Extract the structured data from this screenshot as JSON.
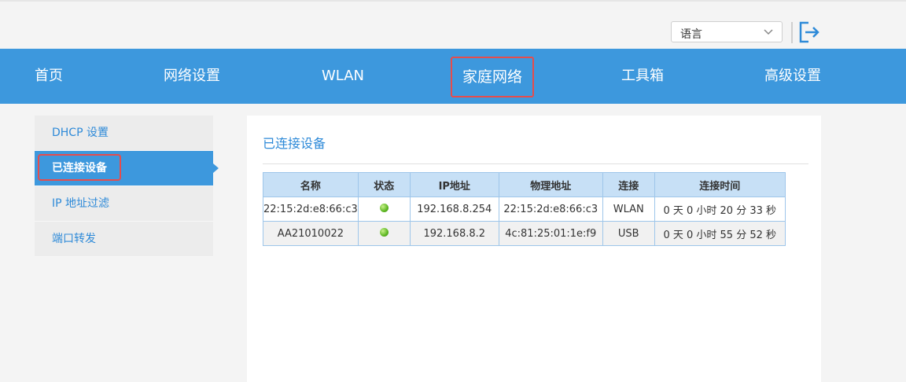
{
  "header": {
    "language_select": "语言"
  },
  "nav": {
    "items": [
      {
        "label": "首页"
      },
      {
        "label": "网络设置"
      },
      {
        "label": "WLAN"
      },
      {
        "label": "家庭网络"
      },
      {
        "label": "工具箱"
      },
      {
        "label": "高级设置"
      }
    ],
    "active": "家庭网络"
  },
  "sidebar": {
    "items": [
      {
        "label": "DHCP 设置"
      },
      {
        "label": "已连接设备"
      },
      {
        "label": "IP 地址过滤"
      },
      {
        "label": "端口转发"
      }
    ],
    "active": "已连接设备"
  },
  "main": {
    "title": "已连接设备",
    "table": {
      "headers": [
        "名称",
        "状态",
        "IP地址",
        "物理地址",
        "连接",
        "连接时间"
      ],
      "rows": [
        {
          "name": "22:15:2d:e8:66:c3",
          "status": "green",
          "ip": "192.168.8.254",
          "mac": "22:15:2d:e8:66:c3",
          "conn": "WLAN",
          "time": "0 天 0 小时 20 分 33 秒"
        },
        {
          "name": "AA21010022",
          "status": "green",
          "ip": "192.168.8.2",
          "mac": "4c:81:25:01:1e:f9",
          "conn": "USB",
          "time": "0 天 0 小时 55 分 52 秒"
        }
      ]
    }
  },
  "colors": {
    "nav_bg": "#3d98dd",
    "accent_text": "#2e8ad8",
    "highlight_border": "#e64c4c",
    "status_online": "#5db622"
  },
  "icons": [
    "chevron-down-icon",
    "logout-icon",
    "status-online-icon"
  ]
}
